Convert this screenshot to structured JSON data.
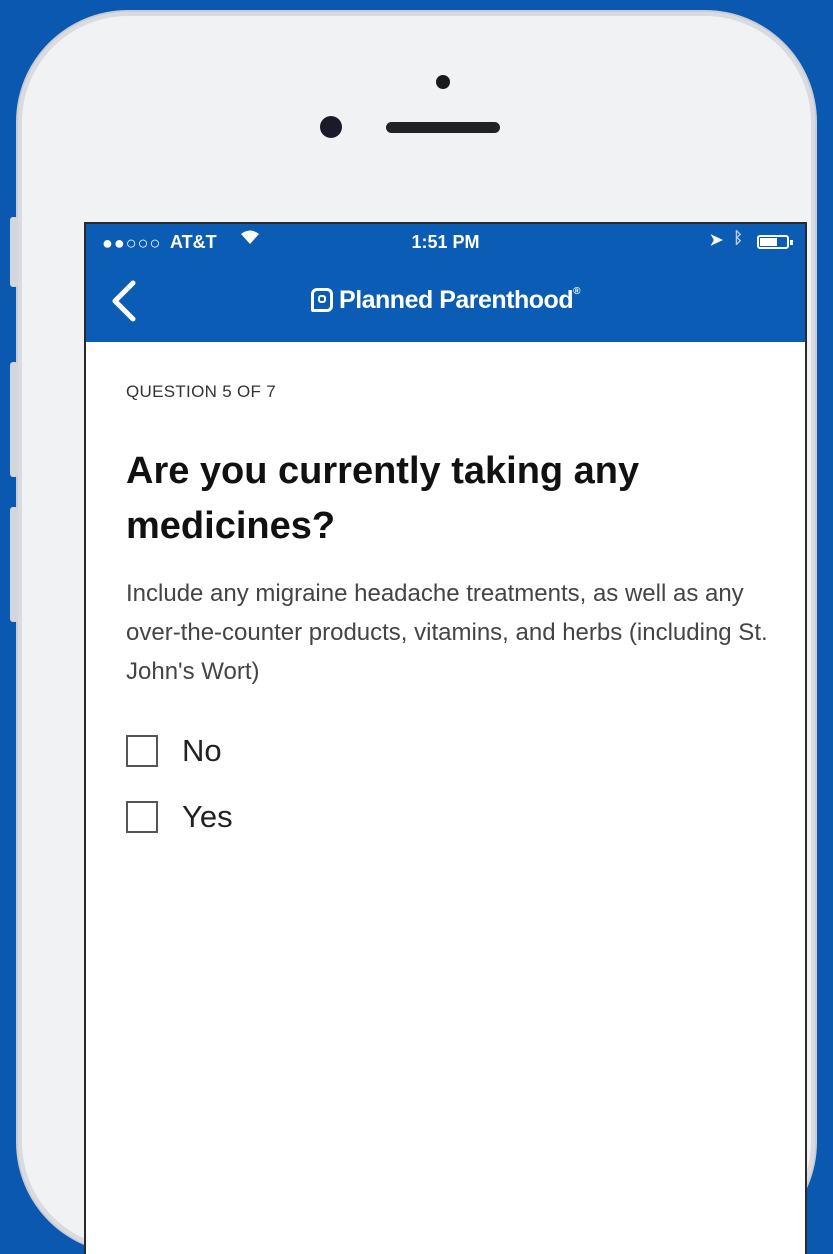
{
  "status_bar": {
    "signal": "●●○○○",
    "carrier": "AT&T",
    "wifi_icon": "wifi-icon",
    "time": "1:51 PM",
    "location_icon": "location-arrow-icon",
    "bluetooth_icon": "bluetooth-icon",
    "battery_icon": "battery-icon"
  },
  "nav": {
    "back_icon": "back-chevron-icon",
    "brand": "Planned Parenthood",
    "trademark": "®"
  },
  "question": {
    "counter": "QUESTION 5 OF 7",
    "title": "Are you currently taking any medicines?",
    "description": "Include any migraine headache treatments, as well as any over-the-counter products, vitamins, and herbs (including St. John's Wort)",
    "options": [
      {
        "label": "No",
        "checked": false
      },
      {
        "label": "Yes",
        "checked": false
      }
    ]
  },
  "colors": {
    "background": "#0a58b0",
    "brand_blue": "#0b5cb5",
    "phone_body": "#f1f2f4"
  }
}
